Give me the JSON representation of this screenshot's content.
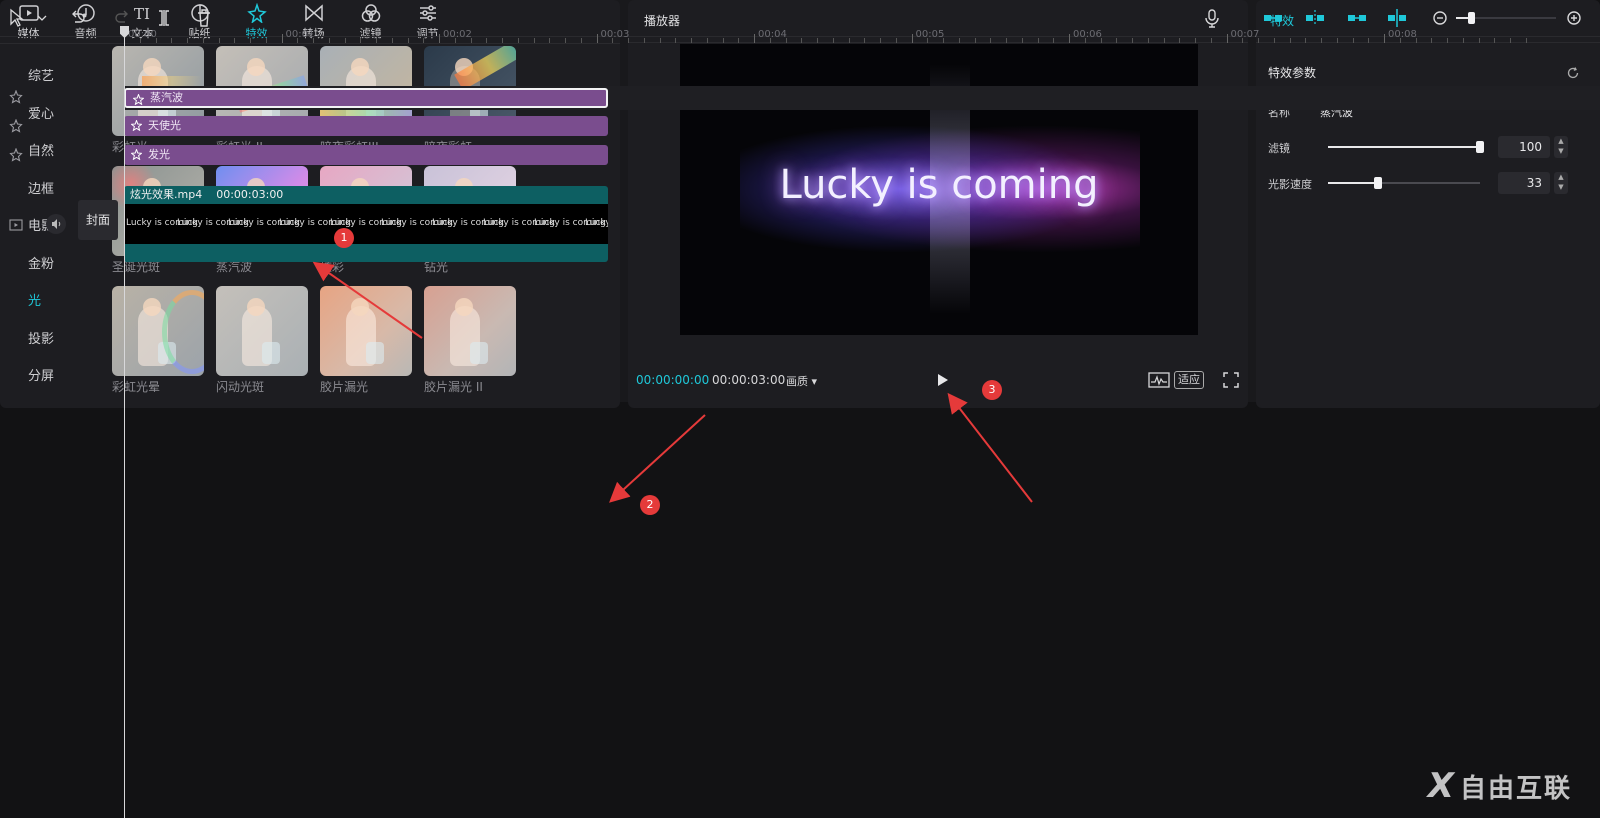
{
  "library": {
    "tabs": [
      {
        "label": "媒体",
        "icon": "media-icon"
      },
      {
        "label": "音频",
        "icon": "audio-icon"
      },
      {
        "label": "文本",
        "icon": "text-icon"
      },
      {
        "label": "贴纸",
        "icon": "sticker-icon"
      },
      {
        "label": "特效",
        "icon": "effects-icon",
        "active": true
      },
      {
        "label": "转场",
        "icon": "transition-icon"
      },
      {
        "label": "滤镜",
        "icon": "filter-icon"
      },
      {
        "label": "调节",
        "icon": "adjust-icon"
      }
    ],
    "categories": [
      "综艺",
      "爱心",
      "自然",
      "边框",
      "电影",
      "金粉",
      "光",
      "投影",
      "分屏"
    ],
    "active_category": "光",
    "effects": [
      {
        "name": "彩虹光"
      },
      {
        "name": "彩虹光 II"
      },
      {
        "name": "暗夜彩虹III"
      },
      {
        "name": "暗夜彩虹"
      },
      {
        "name": "圣诞光斑"
      },
      {
        "name": "蒸汽波"
      },
      {
        "name": "炫彩"
      },
      {
        "name": "钻光"
      },
      {
        "name": "彩虹光晕"
      },
      {
        "name": "闪动光斑"
      },
      {
        "name": "胶片漏光"
      },
      {
        "name": "胶片漏光 II"
      }
    ]
  },
  "player": {
    "title": "播放器",
    "preview_text": "Lucky is coming",
    "current_time": "00:00:00:00",
    "total_time": "00:00:03:00",
    "quality_label": "画质",
    "fit_label": "适应"
  },
  "properties": {
    "title": "特效",
    "section": "特效参数",
    "name_label": "名称",
    "name_value": "蒸汽波",
    "params": [
      {
        "label": "滤镜",
        "value": "100",
        "fraction": 1.0
      },
      {
        "label": "光影速度",
        "value": "33",
        "fraction": 0.33
      }
    ]
  },
  "timeline": {
    "ruler_labels": [
      "00:00",
      "00:01",
      "00:02",
      "00:03",
      "00:04",
      "00:05",
      "00:06",
      "00:07",
      "00:08"
    ],
    "effect_clips": [
      "蒸汽波",
      "天使光",
      "发光"
    ],
    "video_clip": {
      "name": "炫光效果.mp4",
      "duration": "00:00:03:00",
      "frame_text": "Lucky is coming"
    },
    "cover_label": "封面"
  },
  "annotations": {
    "badges": [
      "1",
      "2",
      "3"
    ]
  },
  "watermark": {
    "mark": "X",
    "text": "自由互联"
  },
  "colors": {
    "accent": "#1fc8d9",
    "clip": "#7a4d8e",
    "video": "#0d5f62",
    "annotation": "#e53a3a"
  }
}
